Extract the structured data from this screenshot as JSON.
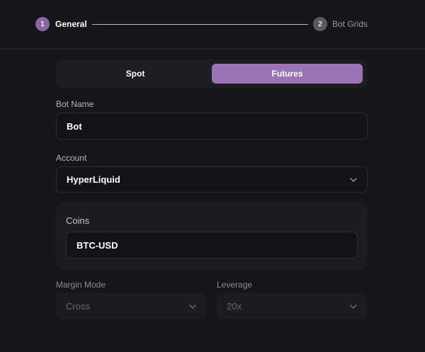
{
  "stepper": {
    "steps": [
      {
        "num": "1",
        "label": "General"
      },
      {
        "num": "2",
        "label": "Bot Grids"
      }
    ]
  },
  "market_toggle": {
    "options": [
      "Spot",
      "Futures"
    ],
    "selected": "Futures"
  },
  "bot_name": {
    "label": "Bot Name",
    "value": "Bot"
  },
  "account": {
    "label": "Account",
    "value": "HyperLiquid"
  },
  "coins": {
    "label": "Coins",
    "value": "BTC-USD"
  },
  "margin_mode": {
    "label": "Margin Mode",
    "value": "Cross"
  },
  "leverage": {
    "label": "Leverage",
    "value": "20x"
  },
  "colors": {
    "accent": "#9a74b5",
    "background": "#17151a"
  }
}
